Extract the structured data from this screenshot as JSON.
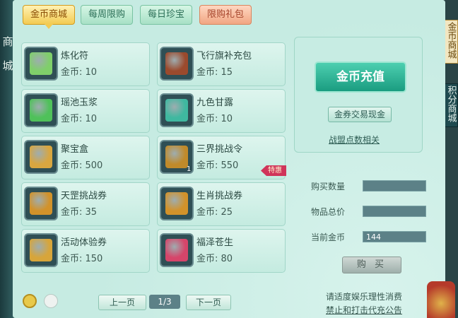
{
  "tabs": [
    {
      "label": "金币商城",
      "active": true
    },
    {
      "label": "每周限购"
    },
    {
      "label": "每日珍宝"
    },
    {
      "label": "限购礼包"
    }
  ],
  "left_edge": {
    "chars": [
      "商",
      "城"
    ]
  },
  "right_tabs": [
    {
      "label": "金币商城"
    },
    {
      "label": "积分商城"
    }
  ],
  "items": [
    {
      "name": "炼化符",
      "price": "金币: 10",
      "icon": "talisman-icon",
      "color": "#7fcf6a"
    },
    {
      "name": "飞行旗补充包",
      "price": "金币: 15",
      "icon": "flag-pouch-icon",
      "color": "#9b4a2d"
    },
    {
      "name": "瑶池玉浆",
      "price": "金币: 10",
      "icon": "jade-jar-icon",
      "color": "#4fc15a"
    },
    {
      "name": "九色甘露",
      "price": "金币: 10",
      "icon": "gem-icon",
      "color": "#3fb8a0"
    },
    {
      "name": "聚宝盒",
      "price": "金币: 500",
      "icon": "treasure-box-icon",
      "color": "#d8a640"
    },
    {
      "name": "三界挑战令",
      "price": "金币: 550",
      "icon": "token-icon",
      "color": "#c08a2a",
      "count": "1",
      "ribbon": "特惠"
    },
    {
      "name": "天罡挑战券",
      "price": "金币: 35",
      "icon": "scroll-icon",
      "color": "#d2922a"
    },
    {
      "name": "生肖挑战券",
      "price": "金币: 25",
      "icon": "scroll-icon",
      "color": "#d2922a"
    },
    {
      "name": "活动体验券",
      "price": "金币: 150",
      "icon": "scroll-icon",
      "color": "#d7a53a"
    },
    {
      "name": "福泽苍生",
      "price": "金币: 80",
      "icon": "potion-icon",
      "color": "#d6456a"
    }
  ],
  "side": {
    "recharge_label": "金币充值",
    "exchange_label": "金券交易现金",
    "link_label": "战盟点数相关"
  },
  "form": {
    "qty_label": "购买数量",
    "qty_value": "",
    "total_label": "物品总价",
    "total_value": "",
    "gold_label": "当前金币",
    "gold_value": "144",
    "buy_label": "购 买"
  },
  "pager": {
    "prev": "上一页",
    "page": "1/3",
    "next": "下一页"
  },
  "notice": {
    "line1": "请适度娱乐理性消费",
    "line2": "禁止和打击代充公告"
  },
  "colors": {
    "accent": "#1a9c80",
    "panel": "#c6ebe2",
    "gold": "#f3cb52"
  }
}
